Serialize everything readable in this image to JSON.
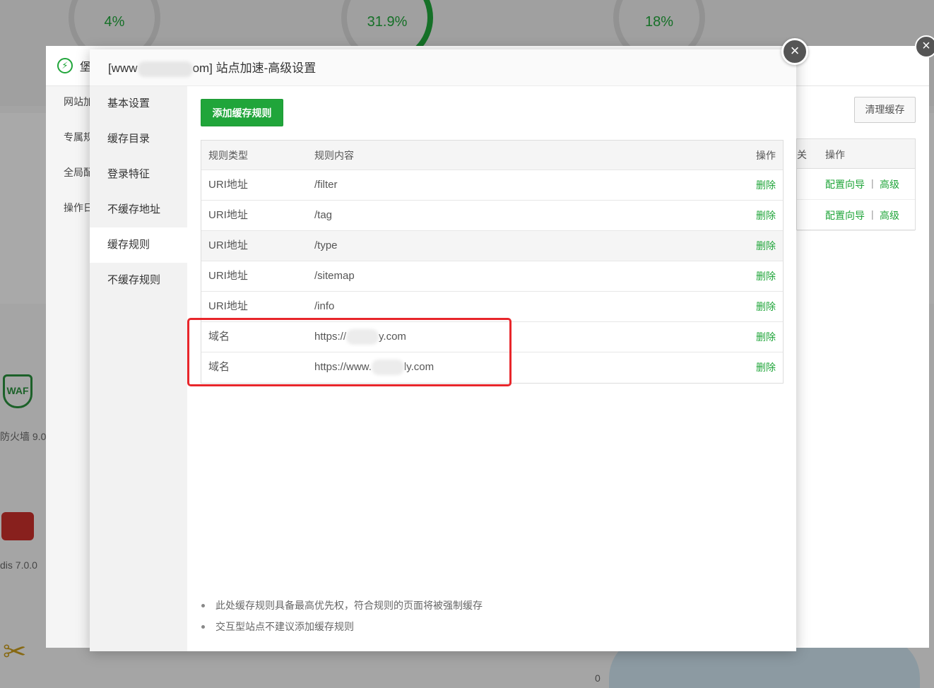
{
  "background": {
    "gauges": [
      {
        "value": "4%"
      },
      {
        "value": "31.9%"
      },
      {
        "value": "18%"
      }
    ],
    "waf_label": "防火墙 9.0",
    "waf_icon_text": "WAF",
    "redis_label": "dis 7.0.0",
    "chart_zero": "0"
  },
  "outer_modal": {
    "title": "堡",
    "side_items": [
      "网站加",
      "专属规",
      "全局配",
      "操作日"
    ],
    "clear_cache_label": "清理缓存",
    "table_headers": [
      "关",
      "操作"
    ],
    "rows": [
      {
        "link1": "配置向导",
        "sep": "|",
        "link2": "高级"
      },
      {
        "link1": "配置向导",
        "sep": "|",
        "link2": "高级"
      }
    ],
    "close_icon": "×"
  },
  "modal": {
    "title_prefix": "[www",
    "title_suffix": "om] 站点加速-高级设置",
    "close_icon": "×",
    "side_items": [
      "基本设置",
      "缓存目录",
      "登录特征",
      "不缓存地址",
      "缓存规则",
      "不缓存规则"
    ],
    "active_side_index": 4,
    "add_button_label": "添加缓存规则",
    "table": {
      "headers": [
        "规则类型",
        "规则内容",
        "操作"
      ],
      "rows": [
        {
          "type": "URI地址",
          "content": "/filter",
          "action": "删除"
        },
        {
          "type": "URI地址",
          "content": "/tag",
          "action": "删除"
        },
        {
          "type": "URI地址",
          "content": "/type",
          "action": "删除"
        },
        {
          "type": "URI地址",
          "content": "/sitemap",
          "action": "删除"
        },
        {
          "type": "URI地址",
          "content": "/info",
          "action": "删除"
        },
        {
          "type": "域名",
          "content_prefix": "https://",
          "content_suffix": "y.com",
          "action": "删除"
        },
        {
          "type": "域名",
          "content_prefix": "https://www.",
          "content_suffix": "ly.com",
          "action": "删除"
        }
      ]
    },
    "notes": [
      "此处缓存规则具备最高优先权，符合规则的页面将被强制缓存",
      "交互型站点不建议添加缓存规则"
    ]
  },
  "colors": {
    "accent": "#20a53a",
    "highlight_box": "#e8262b"
  }
}
